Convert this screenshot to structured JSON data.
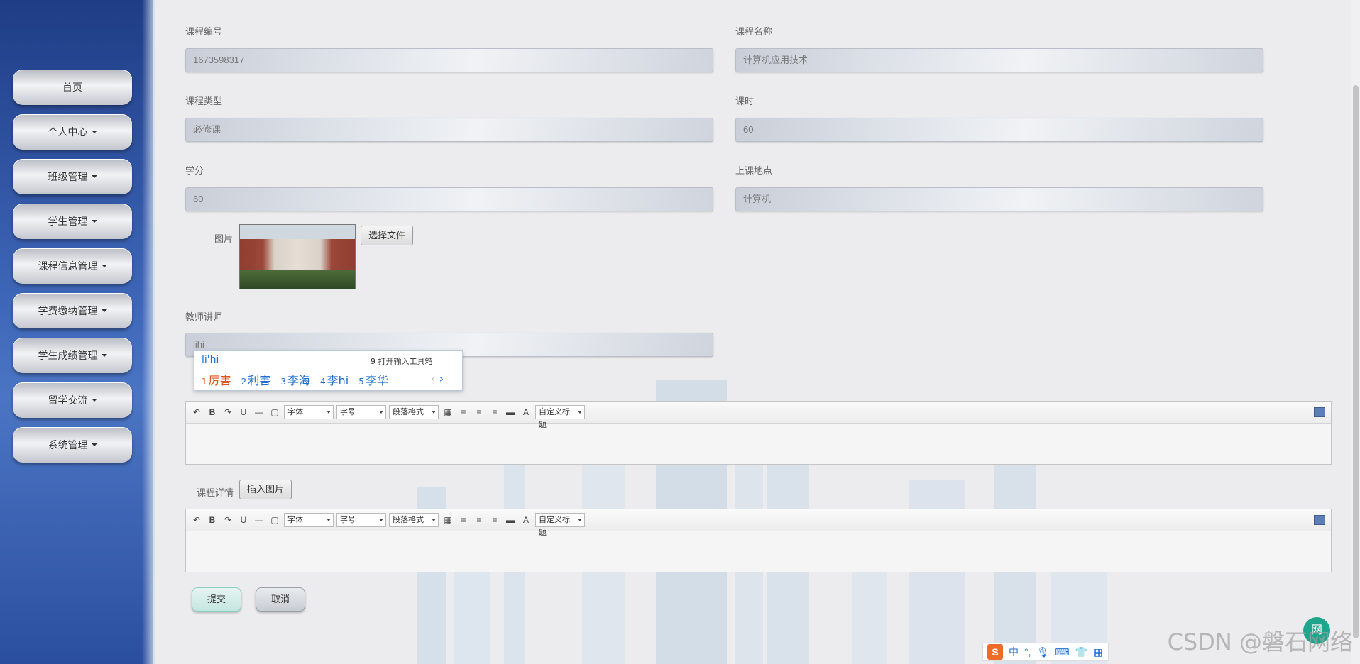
{
  "sidebar": {
    "items": [
      {
        "label": "首页",
        "dropdown": false
      },
      {
        "label": "个人中心",
        "dropdown": true
      },
      {
        "label": "班级管理",
        "dropdown": true
      },
      {
        "label": "学生管理",
        "dropdown": true
      },
      {
        "label": "课程信息管理",
        "dropdown": true
      },
      {
        "label": "学费缴纳管理",
        "dropdown": true
      },
      {
        "label": "学生成绩管理",
        "dropdown": true
      },
      {
        "label": "留学交流",
        "dropdown": true
      },
      {
        "label": "系统管理",
        "dropdown": true
      }
    ]
  },
  "form": {
    "course_no": {
      "label": "课程编号",
      "value": "1673598317"
    },
    "course_name": {
      "label": "课程名称",
      "value": "计算机应用技术"
    },
    "course_type": {
      "label": "课程类型",
      "value": "必修课"
    },
    "hours": {
      "label": "课时",
      "value": "60"
    },
    "credits": {
      "label": "学分",
      "value": "60"
    },
    "location": {
      "label": "上课地点",
      "value": "计算机"
    },
    "image": {
      "label": "图片",
      "choose_label": "选择文件"
    },
    "teacher": {
      "label": "教师讲师",
      "value": "lihi"
    },
    "detail": {
      "label": "课程详情",
      "insert_label": "插入图片"
    },
    "submit_label": "提交",
    "cancel_label": "取消"
  },
  "editor": {
    "font": "字体",
    "size": "字号",
    "paragraph": "段落格式",
    "custom_title": "自定义标题",
    "text_color_glyph": "A"
  },
  "ime": {
    "pinyin": "li'hi",
    "toolbox": "9 打开输入工具箱",
    "candidates": [
      {
        "num": "1",
        "text": "厉害"
      },
      {
        "num": "2",
        "text": "利害"
      },
      {
        "num": "3",
        "text": "李海"
      },
      {
        "num": "4",
        "text": "李hi"
      },
      {
        "num": "5",
        "text": "李华"
      }
    ],
    "lang": "中",
    "prev": "‹",
    "next": "›"
  },
  "watermark": "CSDN @磐石网络",
  "fab_text": "网"
}
